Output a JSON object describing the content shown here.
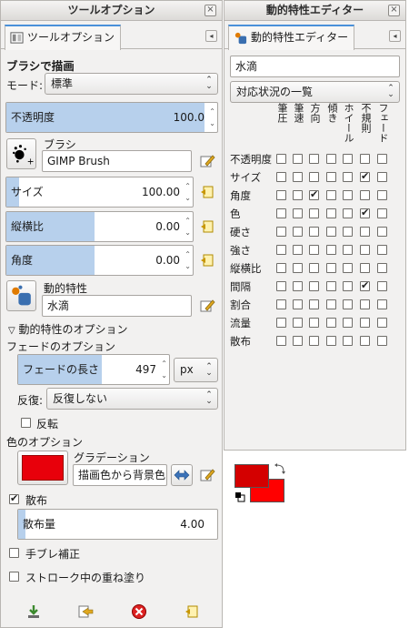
{
  "tool_options": {
    "title": "ツールオプション",
    "close": "×",
    "tab_label": "ツールオプション",
    "tab_menu": "◂",
    "heading": "ブラシで描画",
    "mode_label": "モード:",
    "mode_value": "標準",
    "opacity": {
      "label": "不透明度",
      "value": "100.0",
      "fraction": 1.0
    },
    "brush": {
      "label": "ブラシ",
      "value": "GIMP Brush"
    },
    "size": {
      "label": "サイズ",
      "value": "100.00",
      "fraction": 0.07
    },
    "aspect": {
      "label": "縦横比",
      "value": "0.00",
      "fraction": 0.5
    },
    "angle": {
      "label": "角度",
      "value": "0.00",
      "fraction": 0.5
    },
    "dynamics": {
      "label": "動的特性",
      "value": "水滴"
    },
    "dynamics_options_label": "動的特性のオプション",
    "fade_options_label": "フェードのオプション",
    "fade_length": {
      "label": "フェードの長さ",
      "value": "497",
      "unit": "px"
    },
    "repeat_label": "反復:",
    "repeat_value": "反復しない",
    "reverse_label": "反転",
    "color_options_label": "色のオプション",
    "gradient": {
      "label": "グラデーション",
      "value": "描画色から背景色",
      "swatch_color": "#e8000b"
    },
    "scatter": {
      "label": "散布",
      "checked": true
    },
    "scatter_amount": {
      "label": "散布量",
      "value": "4.00",
      "fraction": 0.04
    },
    "jitter_label": "手ブレ補正",
    "incremental_label": "ストローク中の重ね塗り"
  },
  "dynamics_editor": {
    "title": "動的特性エディター",
    "close": "×",
    "tab_label": "動的特性エディター",
    "tab_menu": "◂",
    "name_value": "水滴",
    "view_value": "対応状況の一覧",
    "columns": [
      "筆圧",
      "筆速",
      "方向",
      "傾き",
      "ホイール",
      "不規則",
      "フェード"
    ],
    "rows": [
      {
        "label": "不透明度",
        "checks": [
          false,
          false,
          false,
          false,
          false,
          false,
          false
        ]
      },
      {
        "label": "サイズ",
        "checks": [
          false,
          false,
          false,
          false,
          false,
          true,
          false
        ]
      },
      {
        "label": "角度",
        "checks": [
          false,
          false,
          true,
          false,
          false,
          false,
          false
        ]
      },
      {
        "label": "色",
        "checks": [
          false,
          false,
          false,
          false,
          false,
          true,
          false
        ]
      },
      {
        "label": "硬さ",
        "checks": [
          false,
          false,
          false,
          false,
          false,
          false,
          false
        ]
      },
      {
        "label": "強さ",
        "checks": [
          false,
          false,
          false,
          false,
          false,
          false,
          false
        ]
      },
      {
        "label": "縦横比",
        "checks": [
          false,
          false,
          false,
          false,
          false,
          false,
          false
        ]
      },
      {
        "label": "間隔",
        "checks": [
          false,
          false,
          false,
          false,
          false,
          true,
          false
        ]
      },
      {
        "label": "割合",
        "checks": [
          false,
          false,
          false,
          false,
          false,
          false,
          false
        ]
      },
      {
        "label": "流量",
        "checks": [
          false,
          false,
          false,
          false,
          false,
          false,
          false
        ]
      },
      {
        "label": "散布",
        "checks": [
          false,
          false,
          false,
          false,
          false,
          false,
          false
        ]
      }
    ]
  },
  "colors": {
    "foreground": "#d40000",
    "background": "#ff0000",
    "accent": "#4a90d9"
  }
}
